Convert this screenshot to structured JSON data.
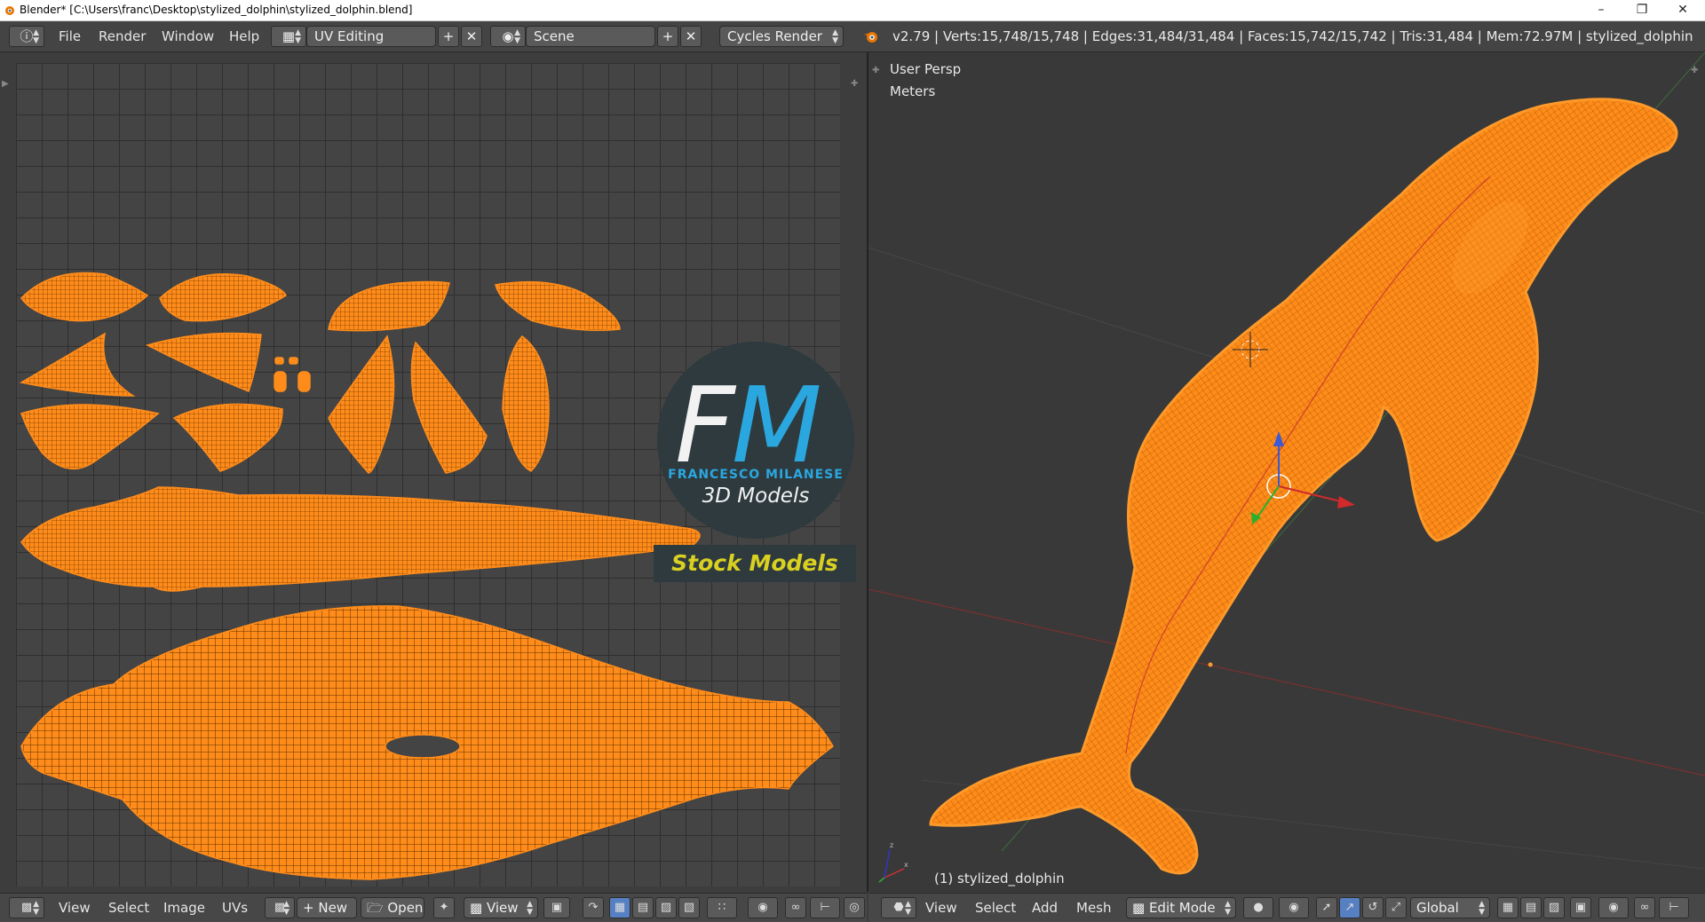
{
  "window": {
    "title": "Blender* [C:\\Users\\franc\\Desktop\\stylized_dolphin\\stylized_dolphin.blend]",
    "controls": [
      "minimize-icon",
      "restore-icon",
      "close-icon"
    ]
  },
  "info_header": {
    "menus": [
      "File",
      "Render",
      "Window",
      "Help"
    ],
    "screen_layout": "UV Editing",
    "scene": "Scene",
    "render_engine": "Cycles Render",
    "stats": "v2.79 | Verts:15,748/15,748 | Edges:31,484/31,484 | Faces:15,742/15,742 | Tris:31,484 | Mem:72.97M | stylized_dolphin"
  },
  "uv_editor": {
    "menus": [
      "View",
      "Select",
      "Image",
      "UVs"
    ],
    "new_label": "New",
    "open_label": "Open",
    "view_label": "View"
  },
  "viewport": {
    "view_name": "User Persp",
    "units": "Meters",
    "object_label": "(1) stylized_dolphin",
    "menus": [
      "View",
      "Select",
      "Add",
      "Mesh"
    ],
    "mode": "Edit Mode",
    "orientation": "Global"
  },
  "watermark": {
    "letters_f": "F",
    "letters_m": "M",
    "name": "FRANCESCO MILANESE",
    "tagline": "3D Models",
    "banner": "Stock Models"
  },
  "colors": {
    "mesh": "#ff8c1a",
    "accent_blue": "#2ba7e0",
    "banner_yellow": "#d9d021"
  }
}
